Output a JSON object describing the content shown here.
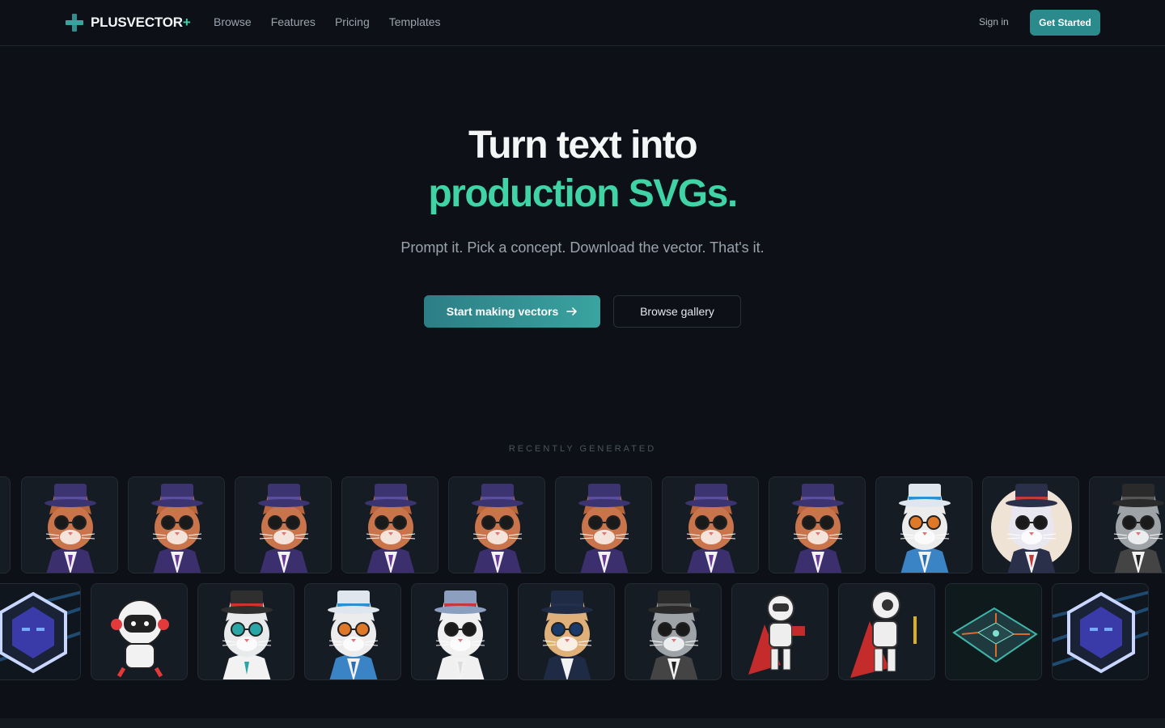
{
  "nav": {
    "brand": "PLUSVECTOR",
    "brand_suffix": "+",
    "links": [
      "Browse",
      "Features",
      "Pricing",
      "Templates"
    ],
    "signin": "Sign in",
    "cta": "Get Started"
  },
  "hero": {
    "title_line1": "Turn text into",
    "title_line2": "production SVGs.",
    "subtitle": "Prompt it. Pick a concept. Download the vector. That's it.",
    "primary_button": "Start making vectors",
    "secondary_button": "Browse gallery"
  },
  "gallery": {
    "heading": "RECENTLY GENERATED",
    "row1": [
      "hamster-fox",
      "hamster-fox",
      "hamster-fox",
      "hamster-fox",
      "hamster-fox",
      "hamster-fox",
      "hamster-fox",
      "hamster-fox",
      "cat-orange-glasses",
      "cat-round-badge",
      "cat-grey-glasses",
      "hamster-fox"
    ],
    "row2": [
      "robot-hex",
      "astronaut-chibi",
      "cat-teal-hat",
      "cat-orange-glasses",
      "cat-tall-hat",
      "cat-blue-hat",
      "cat-grey-glasses",
      "robot-red-cape",
      "robot-red-cape-2",
      "circuit-board",
      "robot-hex"
    ]
  },
  "colors": {
    "accent_green": "#3fd3a5",
    "accent_teal": "#2a8a8c",
    "bg": "#0d1117"
  }
}
